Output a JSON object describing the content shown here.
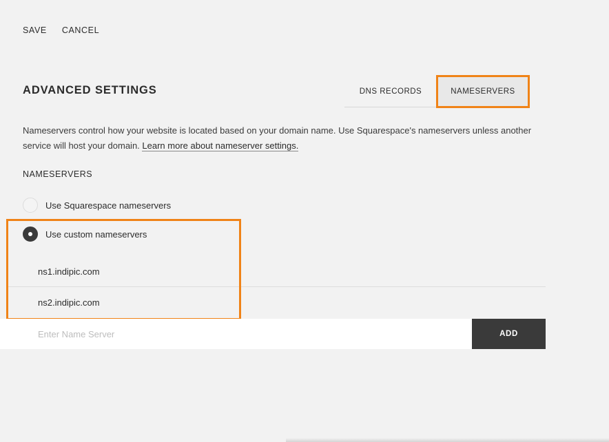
{
  "toolbar": {
    "save_label": "SAVE",
    "cancel_label": "CANCEL"
  },
  "section": {
    "title": "ADVANCED SETTINGS"
  },
  "tabs": [
    {
      "label": "DNS RECORDS",
      "active": false
    },
    {
      "label": "NAMESERVERS",
      "active": true
    }
  ],
  "description": {
    "text": "Nameservers control how your website is located based on your domain name. Use Squarespace's nameservers unless another service will host your domain. ",
    "link_text": "Learn more about nameserver settings."
  },
  "nameservers": {
    "label": "NAMESERVERS",
    "options": [
      {
        "label": "Use Squarespace nameservers",
        "checked": false
      },
      {
        "label": "Use custom nameservers",
        "checked": true
      }
    ],
    "entries": [
      "ns1.indipic.com",
      "ns2.indipic.com"
    ],
    "input_placeholder": "Enter Name Server",
    "input_value": "",
    "add_label": "ADD"
  },
  "colors": {
    "highlight": "#f08317",
    "background": "#f2f2f2",
    "dark_button": "#3a3a3a"
  },
  "icons": {
    "radio_unchecked": "radio-unchecked-icon",
    "radio_checked": "radio-checked-icon"
  }
}
